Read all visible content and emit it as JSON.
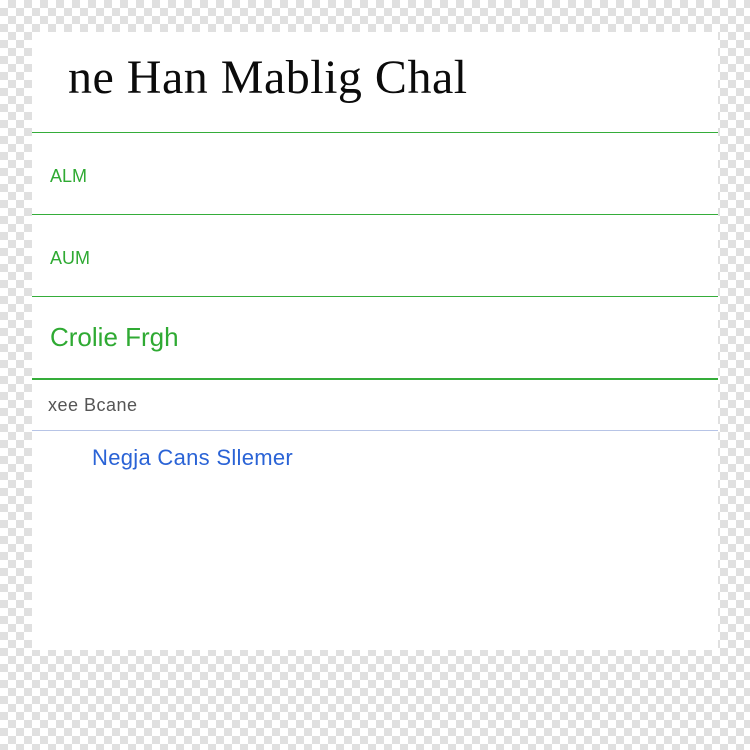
{
  "header": {
    "title": "ne Han Mablig Chal"
  },
  "list": {
    "items": [
      {
        "label": "alm"
      },
      {
        "label": "aum"
      },
      {
        "label": "Crolie Frgh"
      }
    ]
  },
  "dropdown": {
    "value": "xee Bcane"
  },
  "link": {
    "text": "Negja Cans Sllemer"
  }
}
